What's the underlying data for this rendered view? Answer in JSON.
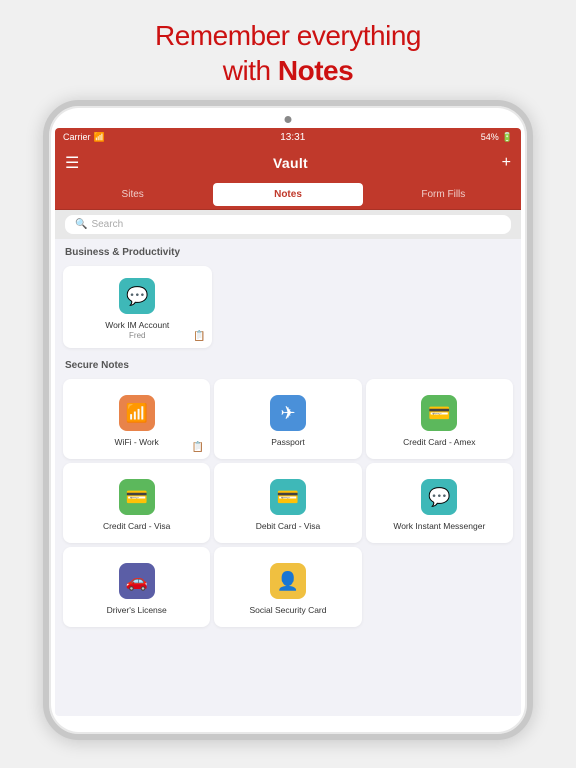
{
  "promo": {
    "line1": "Remember everything",
    "line2": "with ",
    "highlight": "Notes"
  },
  "statusBar": {
    "carrier": "Carrier",
    "time": "13:31",
    "battery": "54%"
  },
  "navBar": {
    "title": "Vault",
    "menuIcon": "☰",
    "addIcon": "+"
  },
  "tabs": [
    {
      "label": "Sites",
      "active": false
    },
    {
      "label": "Notes",
      "active": true
    },
    {
      "label": "Form Fills",
      "active": false
    }
  ],
  "search": {
    "placeholder": "Search"
  },
  "sections": [
    {
      "title": "Business & Productivity",
      "items": [
        {
          "label": "Work IM Account",
          "sub": "Fred",
          "icon": "chat",
          "color": "#3eb8b8",
          "hasNote": true
        }
      ]
    },
    {
      "title": "Secure Notes",
      "items": [
        {
          "label": "WiFi - Work",
          "sub": "",
          "icon": "wifi",
          "color": "#e8834a",
          "hasNote": true
        },
        {
          "label": "Passport",
          "sub": "",
          "icon": "plane",
          "color": "#4a90d9",
          "hasNote": false
        },
        {
          "label": "Credit Card - Amex",
          "sub": "",
          "icon": "creditcard",
          "color": "#5cb85c",
          "hasNote": false
        },
        {
          "label": "Credit Card - Visa",
          "sub": "",
          "icon": "creditcard",
          "color": "#5cb85c",
          "hasNote": false
        },
        {
          "label": "Debit Card - Visa",
          "sub": "",
          "icon": "creditcard",
          "color": "#3eb8b8",
          "hasNote": false
        },
        {
          "label": "Work Instant Messenger",
          "sub": "",
          "icon": "chat",
          "color": "#3eb8b8",
          "hasNote": false
        },
        {
          "label": "Driver's License",
          "sub": "",
          "icon": "car",
          "color": "#5b5ea6",
          "hasNote": false
        },
        {
          "label": "Social Security Card",
          "sub": "",
          "icon": "person",
          "color": "#f0c040",
          "hasNote": false
        }
      ]
    }
  ]
}
